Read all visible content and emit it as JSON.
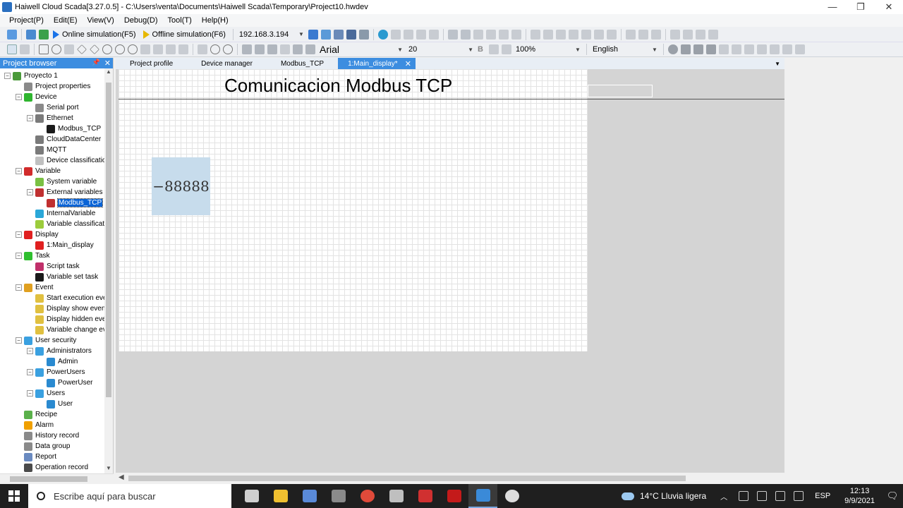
{
  "window": {
    "title": "Haiwell Cloud Scada[3.27.0.5] - C:\\Users\\venta\\Documents\\Haiwell Scada\\Temporary\\Project10.hwdev",
    "controls": [
      "—",
      "❐",
      "✕"
    ]
  },
  "menu": [
    "Project(P)",
    "Edit(E)",
    "View(V)",
    "Debug(D)",
    "Tool(T)",
    "Help(H)"
  ],
  "toolbar": {
    "online_sim": "Online simulation(F5)",
    "offline_sim": "Offline simulation(F6)",
    "ip_address": "192.168.3.194"
  },
  "format_bar": {
    "font": "Arial",
    "size": "20",
    "bold": "B",
    "zoom": "100%",
    "language": "English"
  },
  "project_browser": {
    "title": "Project browser",
    "pin": "📌",
    "close": "✕",
    "tree": [
      {
        "label": "Proyecto 1",
        "level": 0,
        "exp": "−",
        "color": "#4a9a3a"
      },
      {
        "label": "Project properties",
        "level": 1,
        "exp": "",
        "color": "#8a8a8a"
      },
      {
        "label": "Device",
        "level": 1,
        "exp": "−",
        "color": "#2fb52f"
      },
      {
        "label": "Serial port",
        "level": 2,
        "exp": "",
        "color": "#8a8a8a"
      },
      {
        "label": "Ethernet",
        "level": 2,
        "exp": "−",
        "color": "#7a7a7a"
      },
      {
        "label": "Modbus_TCP",
        "level": 3,
        "exp": "",
        "color": "#1a1a1a"
      },
      {
        "label": "CloudDataCenter",
        "level": 2,
        "exp": "",
        "color": "#7a7a7a"
      },
      {
        "label": "MQTT",
        "level": 2,
        "exp": "",
        "color": "#7a7a7a"
      },
      {
        "label": "Device classification",
        "level": 2,
        "exp": "",
        "color": "#c0c0c0"
      },
      {
        "label": "Variable",
        "level": 1,
        "exp": "−",
        "color": "#d12b2b"
      },
      {
        "label": "System variable",
        "level": 2,
        "exp": "",
        "color": "#7ac043"
      },
      {
        "label": "External variables",
        "level": 2,
        "exp": "−",
        "color": "#c03030"
      },
      {
        "label": "Modbus_TCP",
        "level": 3,
        "exp": "",
        "color": "#c03030",
        "selected": true
      },
      {
        "label": "InternalVariable",
        "level": 2,
        "exp": "",
        "color": "#2aa7d8"
      },
      {
        "label": "Variable classification",
        "level": 2,
        "exp": "",
        "color": "#9ccc3c"
      },
      {
        "label": "Display",
        "level": 1,
        "exp": "−",
        "color": "#e02020"
      },
      {
        "label": "1:Main_display",
        "level": 2,
        "exp": "",
        "color": "#e02020"
      },
      {
        "label": "Task",
        "level": 1,
        "exp": "−",
        "color": "#2fbf2f"
      },
      {
        "label": "Script task",
        "level": 2,
        "exp": "",
        "color": "#c0306a"
      },
      {
        "label": "Variable set task",
        "level": 2,
        "exp": "",
        "color": "#1a1a1a"
      },
      {
        "label": "Event",
        "level": 1,
        "exp": "−",
        "color": "#e0a020"
      },
      {
        "label": "Start execution event",
        "level": 2,
        "exp": "",
        "color": "#e0c040"
      },
      {
        "label": "Display show event",
        "level": 2,
        "exp": "",
        "color": "#e0c040"
      },
      {
        "label": "Display hidden event",
        "level": 2,
        "exp": "",
        "color": "#e0c040"
      },
      {
        "label": "Variable change event",
        "level": 2,
        "exp": "",
        "color": "#e0c040"
      },
      {
        "label": "User security",
        "level": 1,
        "exp": "−",
        "color": "#3aa0e0"
      },
      {
        "label": "Administrators",
        "level": 2,
        "exp": "−",
        "color": "#3aa0e0"
      },
      {
        "label": "Admin",
        "level": 3,
        "exp": "",
        "color": "#2a8ad0"
      },
      {
        "label": "PowerUsers",
        "level": 2,
        "exp": "−",
        "color": "#3aa0e0"
      },
      {
        "label": "PowerUser",
        "level": 3,
        "exp": "",
        "color": "#2a8ad0"
      },
      {
        "label": "Users",
        "level": 2,
        "exp": "−",
        "color": "#3aa0e0"
      },
      {
        "label": "User",
        "level": 3,
        "exp": "",
        "color": "#2a8ad0"
      },
      {
        "label": "Recipe",
        "level": 1,
        "exp": "",
        "color": "#5ab04a"
      },
      {
        "label": "Alarm",
        "level": 1,
        "exp": "",
        "color": "#f0a000"
      },
      {
        "label": "History record",
        "level": 1,
        "exp": "",
        "color": "#8a8a8a"
      },
      {
        "label": "Data group",
        "level": 1,
        "exp": "",
        "color": "#8a8a8a"
      },
      {
        "label": "Report",
        "level": 1,
        "exp": "",
        "color": "#6a8ac0"
      },
      {
        "label": "Operation record",
        "level": 1,
        "exp": "",
        "color": "#4a4a4a"
      }
    ]
  },
  "tabs": [
    {
      "label": "Project profile",
      "active": false
    },
    {
      "label": "Device manager",
      "active": false
    },
    {
      "label": "Modbus_TCP",
      "active": false
    },
    {
      "label": "1:Main_display*",
      "active": true
    }
  ],
  "canvas": {
    "title": "Comunicacion Modbus TCP",
    "numeric_display": "−88888"
  },
  "taskbar": {
    "search_placeholder": "Escribe aquí para buscar",
    "weather": "14°C  Lluvia ligera",
    "language": "ESP",
    "time": "12:13",
    "date": "9/9/2021",
    "apps": [
      {
        "name": "task-view",
        "color": "#cfcfcf"
      },
      {
        "name": "file-explorer",
        "color": "#f0c030"
      },
      {
        "name": "app-blue",
        "color": "#5a8ad8"
      },
      {
        "name": "calculator",
        "color": "#8a8a8a"
      },
      {
        "name": "chrome",
        "color": "#e04a3a"
      },
      {
        "name": "app-grey",
        "color": "#bfbfbf"
      },
      {
        "name": "app-red",
        "color": "#d03030"
      },
      {
        "name": "acrobat",
        "color": "#c41a1a"
      },
      {
        "name": "haiwell",
        "color": "#3a8ad8"
      },
      {
        "name": "obs",
        "color": "#dddddd"
      }
    ]
  }
}
